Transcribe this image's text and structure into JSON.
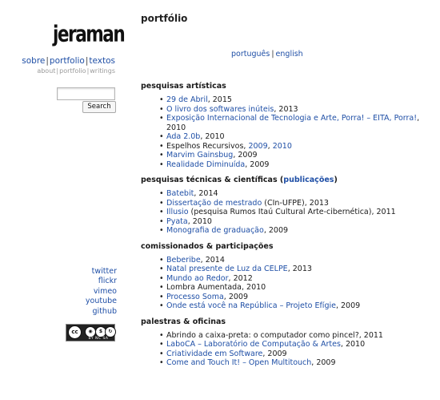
{
  "site": {
    "logo": "jeraman",
    "nav_main": [
      "sobre",
      "portfolio",
      "textos"
    ],
    "nav_sub": [
      "about",
      "portfolio",
      "writings"
    ],
    "search_button": "Search",
    "social": [
      "twitter",
      "flickr",
      "vimeo",
      "youtube",
      "github"
    ],
    "license": {
      "icons": [
        "cc",
        "by",
        "nc",
        "sa"
      ],
      "label": "BY  NC  SA"
    }
  },
  "page": {
    "title": "portfólio",
    "lang": [
      "português",
      "english"
    ]
  },
  "colors": {
    "link": "#1f4fa6",
    "muted": "#9a9a9a"
  },
  "sections": {
    "artisticas": {
      "heading": "pesquisas artísticas",
      "items": [
        {
          "a": "29 de Abril",
          "b": ", 2015"
        },
        {
          "a": " O livro dos softwares inúteis",
          "b": ", 2013"
        },
        {
          "a": "Exposição Internacional de Tecnologia e Arte, Porra! – EITA, Porra!",
          "b": ", 2010"
        },
        {
          "a": "Ada 2.0b",
          "b": ", 2010"
        },
        {
          "p": "Espelhos Recursivos, ",
          "a": "2009",
          "m": ", ",
          "a2": "2010"
        },
        {
          "a": "Marvim Gainsbug",
          "b": ", 2009"
        },
        {
          "a": "Realidade Diminuída",
          "b": ", 2009"
        }
      ]
    },
    "tecnicas": {
      "heading_pre": "pesquisas técnicas & científicas (",
      "heading_link": "publicações",
      "heading_post": ")",
      "items": [
        {
          "a": "Batebit",
          "b": ", 2014"
        },
        {
          "a": "Dissertação de mestrado",
          "b": " (CIn-UFPE), 2013"
        },
        {
          "a": "Illusio",
          "b": " (pesquisa Rumos Itaú Cultural Arte-cibernética), 2011"
        },
        {
          "a": "Pyata",
          "b": ", 2010"
        },
        {
          "a": "Monografia de graduação",
          "b": ", 2009"
        }
      ]
    },
    "comissionados": {
      "heading": "comissionados & participações",
      "items": [
        {
          "a": "Beberibe",
          "b": ", 2014"
        },
        {
          "a": "Natal presente de Luz da CELPE",
          "b": ", 2013"
        },
        {
          "a": "Mundo ao Redor",
          "b": ", 2012"
        },
        {
          "p": "Lombra Aumentada, 2010"
        },
        {
          "a": "Processo Soma",
          "b": ", 2009"
        },
        {
          "a": "Onde está você na República – Projeto Efígie",
          "b": ", 2009"
        }
      ]
    },
    "palestras": {
      "heading": "palestras & oficinas",
      "items": [
        {
          "p": "Abrindo a caixa-preta: o computador como pincel?, 2011"
        },
        {
          "a": "LaboCA – Laboratório de Computação & Artes",
          "b": ", 2010"
        },
        {
          "a": "Criatividade em Software",
          "b": ", 2009"
        },
        {
          "a": "Come and Touch It! – Open Multitouch",
          "b": ", 2009"
        }
      ]
    }
  }
}
